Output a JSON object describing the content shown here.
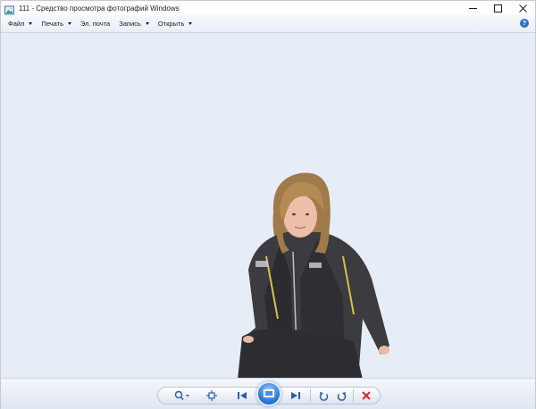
{
  "window": {
    "title": "111 - Средство просмотра фотографий Windows"
  },
  "menu": {
    "items": [
      {
        "label": "Файл",
        "has_arrow": true
      },
      {
        "label": "Печать",
        "has_arrow": true
      },
      {
        "label": "Эл. почта",
        "has_arrow": false
      },
      {
        "label": "Запись",
        "has_arrow": true
      },
      {
        "label": "Открыть",
        "has_arrow": true
      }
    ],
    "help_label": "?"
  },
  "colors": {
    "viewer_background": "#e6edf6",
    "accent_blue": "#2a6fc9",
    "delete_red": "#d62b2b"
  },
  "toolbar": {
    "icons": [
      "zoom-icon",
      "fit-icon",
      "previous-icon",
      "slideshow-icon",
      "next-icon",
      "rotate-counterclockwise-icon",
      "rotate-clockwise-icon",
      "delete-icon"
    ]
  }
}
